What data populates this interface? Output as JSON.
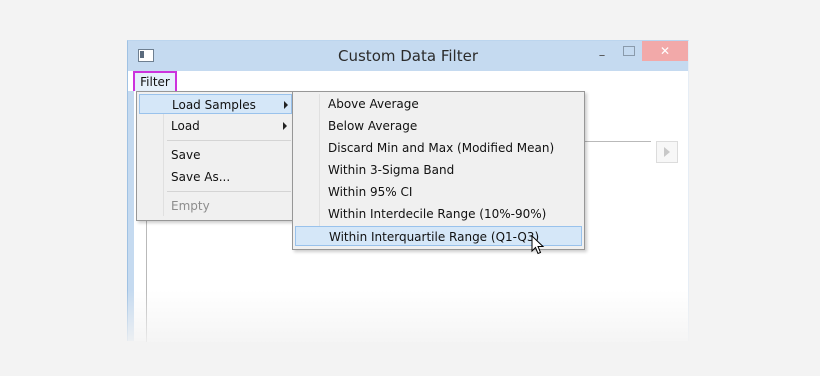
{
  "window": {
    "title": "Custom Data Filter",
    "minimize_glyph": "–",
    "close_glyph": "✕"
  },
  "menubar": {
    "filter_label": "Filter"
  },
  "filter_menu": {
    "items": [
      {
        "label": "Load Samples",
        "has_submenu": true,
        "highlighted": true
      },
      {
        "label": "Load",
        "has_submenu": true
      },
      {
        "label": "Save"
      },
      {
        "label": "Save As..."
      },
      {
        "label": "Empty",
        "disabled": true
      }
    ]
  },
  "samples_menu": {
    "items": [
      {
        "label": "Above Average"
      },
      {
        "label": "Below Average"
      },
      {
        "label": "Discard Min and Max (Modified Mean)"
      },
      {
        "label": "Within 3-Sigma Band"
      },
      {
        "label": "Within 95% CI"
      },
      {
        "label": "Within Interdecile Range (10%-90%)"
      },
      {
        "label": "Within Interquartile Range (Q1-Q3)",
        "highlighted": true
      }
    ]
  },
  "colors": {
    "titlebar": "#c5daf0",
    "highlight": "#d5e7f8",
    "annotation_box": "#cc33dd",
    "close_button": "#f2a9a9"
  },
  "icons": {
    "system_menu": "window-icon",
    "submenu": "chevron-right-icon",
    "cursor": "mouse-pointer-icon",
    "scroll_right": "arrow-right-icon"
  }
}
